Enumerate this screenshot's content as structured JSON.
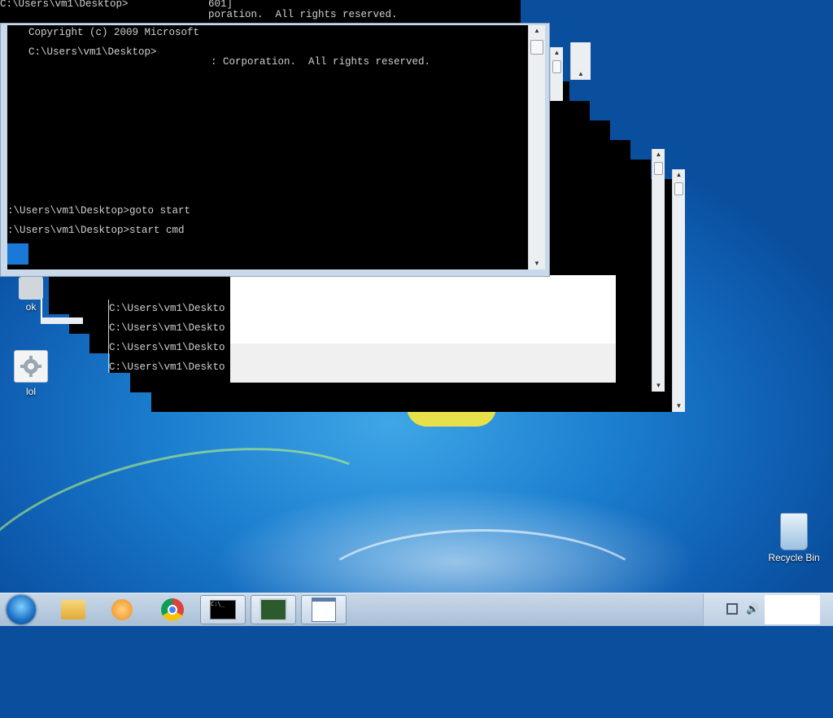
{
  "console_top_strip": {
    "prompt": "C:\\Users\\vm1\\Desktop>",
    "line1": "601]",
    "line2": "poration.  All rights reserved."
  },
  "main_console": {
    "line_copyright": "Copyright (c) 2009 Microsoft",
    "line_prompt": "C:\\Users\\vm1\\Desktop>",
    "line_corp": ": Corporation.  All rights reserved.",
    "line_goto": ":\\Users\\vm1\\Desktop>goto start",
    "line_start": ":\\Users\\vm1\\Desktop>start cmd"
  },
  "back_console": {
    "lines": [
      "C:\\Users\\vm1\\Deskto",
      "C:\\Users\\vm1\\Deskto",
      "C:\\Users\\vm1\\Deskto",
      "C:\\Users\\vm1\\Deskto"
    ]
  },
  "desktop_icons": {
    "ok_label": "ok",
    "lol_label": "lol",
    "recycle_bin_label": "Recycle Bin"
  },
  "taskbar": {
    "start_icon": "windows-start-orb",
    "items": [
      "explorer-icon",
      "media-player-icon",
      "chrome-icon",
      "cmd-icon",
      "system-monitor-icon",
      "document-window-icon"
    ],
    "active_item": "cmd-icon"
  },
  "tray": {
    "icons": [
      "network-icon",
      "volume-icon"
    ]
  },
  "colors": {
    "console_bg": "#000000",
    "console_text": "#d0d0d0",
    "window_frame": "#c9d9ea",
    "desktop_blue": "#1c7fd0"
  }
}
